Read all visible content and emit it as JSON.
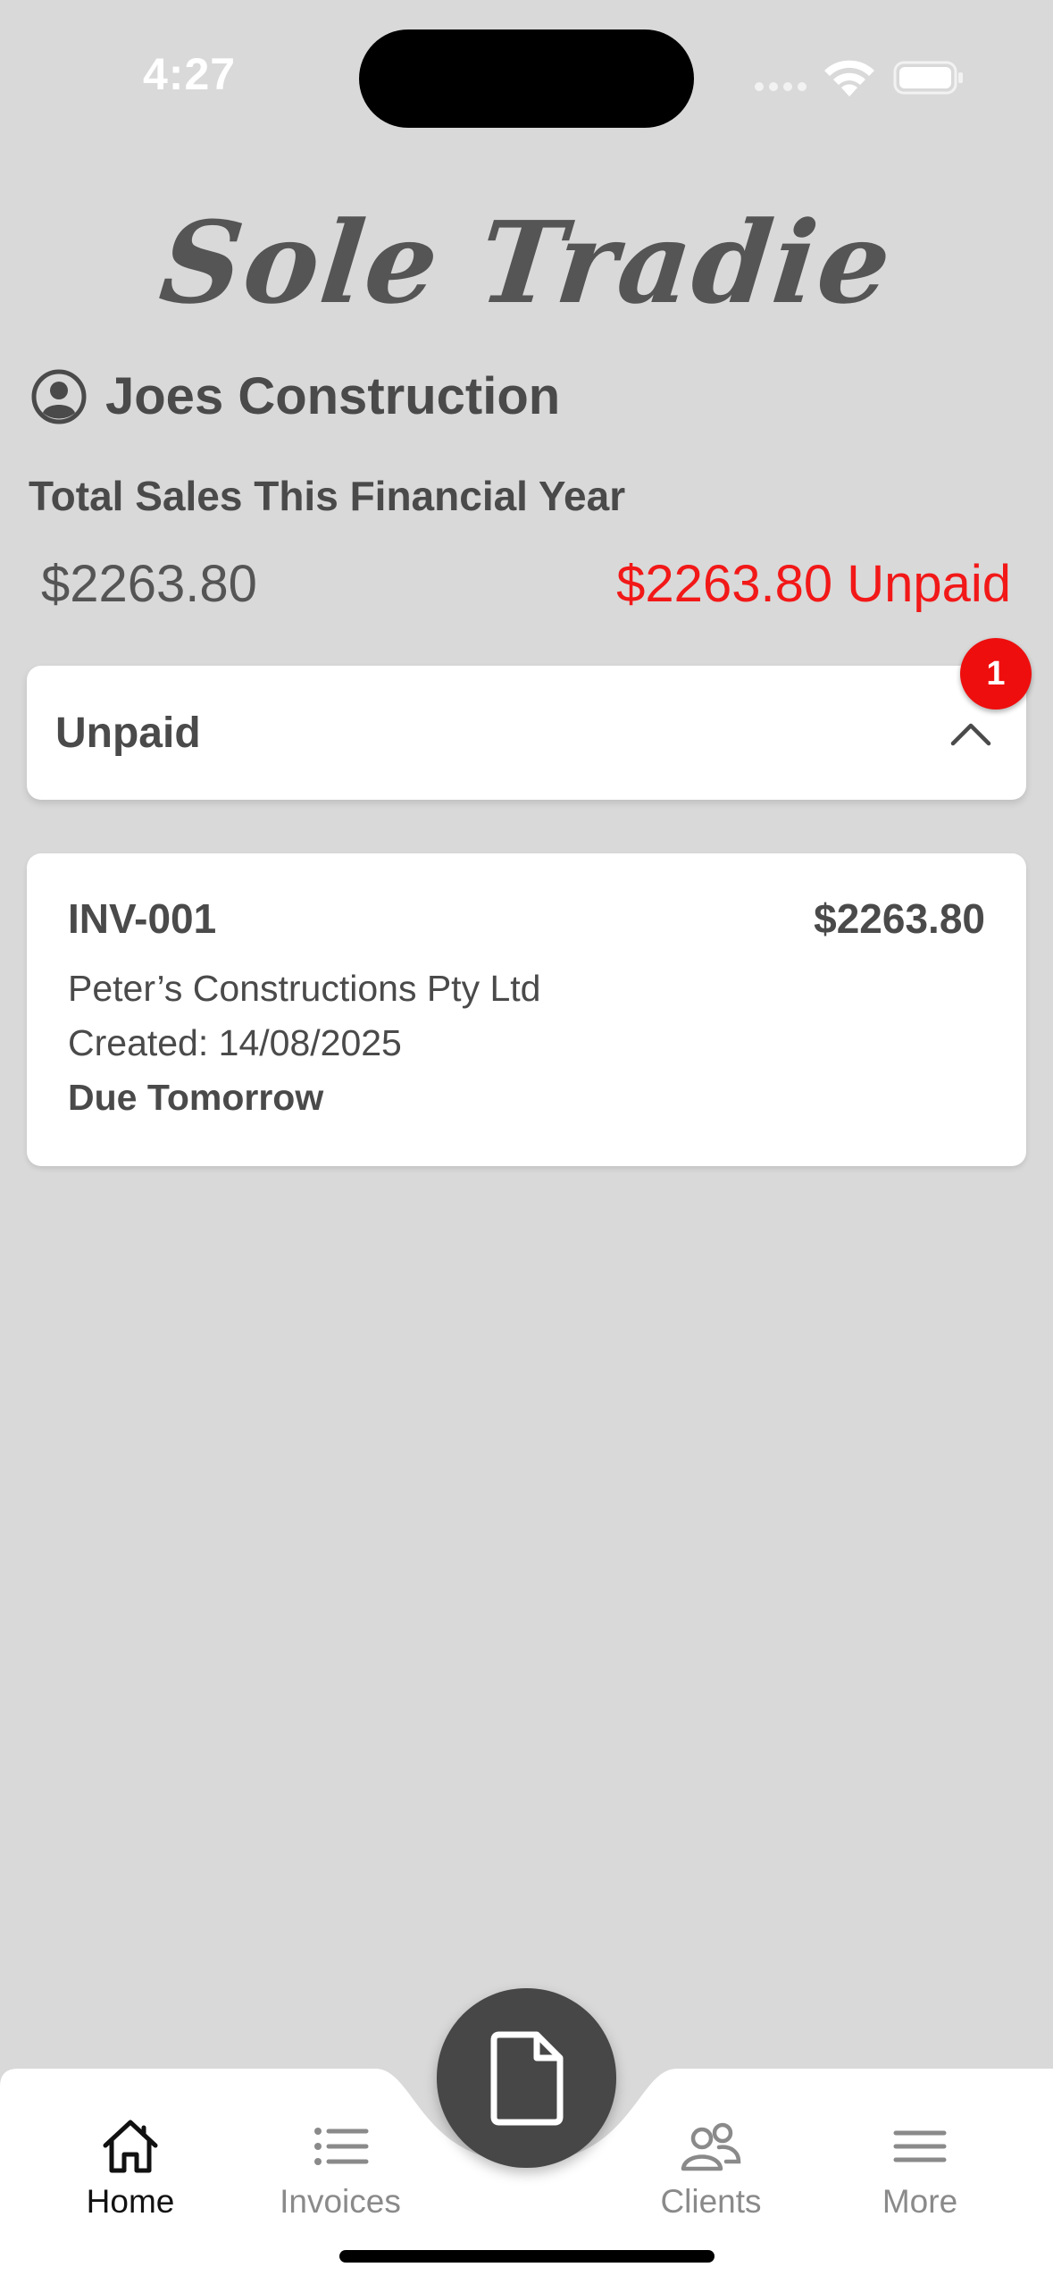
{
  "status_bar": {
    "time": "4:27"
  },
  "brand": {
    "title": "Sole Tradie"
  },
  "company": {
    "name": "Joes Construction",
    "icon": "user-circle-icon"
  },
  "summary": {
    "label": "Total Sales This Financial Year",
    "total": "$2263.80",
    "unpaid": "$2263.80 Unpaid",
    "unpaid_color": "#f21818"
  },
  "unpaid_section": {
    "title": "Unpaid",
    "badge_count": "1",
    "expanded": true,
    "badge_color": "#ee0e0e"
  },
  "invoices": [
    {
      "number": "INV-001",
      "amount": "$2263.80",
      "client": "Peter’s Constructions Pty Ltd",
      "created": "Created: 14/08/2025",
      "due": "Due Tomorrow"
    }
  ],
  "tabbar": {
    "tabs": [
      {
        "label": "Home",
        "icon": "house-icon",
        "active": true
      },
      {
        "label": "Invoices",
        "icon": "list-icon",
        "active": false
      },
      {
        "label": "Clients",
        "icon": "people-icon",
        "active": false
      },
      {
        "label": "More",
        "icon": "menu-icon",
        "active": false
      }
    ],
    "fab_icon": "document-icon"
  }
}
